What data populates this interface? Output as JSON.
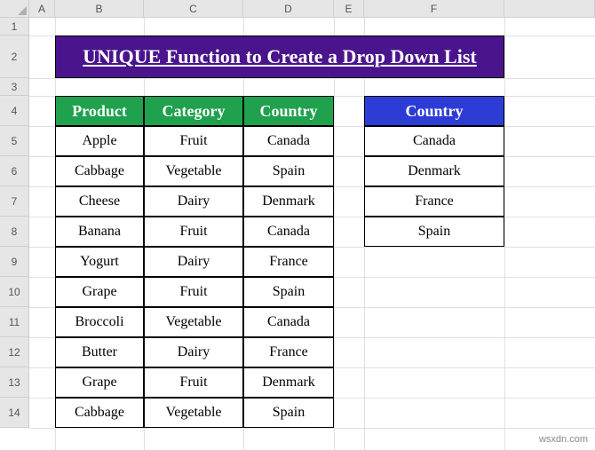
{
  "columns": [
    "A",
    "B",
    "C",
    "D",
    "E",
    "F"
  ],
  "rows": [
    "1",
    "2",
    "3",
    "4",
    "5",
    "6",
    "7",
    "8",
    "9",
    "10",
    "11",
    "12",
    "13",
    "14"
  ],
  "title": "UNIQUE Function to Create a Drop Down List",
  "main_table": {
    "headers": [
      "Product",
      "Category",
      "Country"
    ],
    "data": [
      [
        "Apple",
        "Fruit",
        "Canada"
      ],
      [
        "Cabbage",
        "Vegetable",
        "Spain"
      ],
      [
        "Cheese",
        "Dairy",
        "Denmark"
      ],
      [
        "Banana",
        "Fruit",
        "Canada"
      ],
      [
        "Yogurt",
        "Dairy",
        "France"
      ],
      [
        "Grape",
        "Fruit",
        "Spain"
      ],
      [
        "Broccoli",
        "Vegetable",
        "Canada"
      ],
      [
        "Butter",
        "Dairy",
        "France"
      ],
      [
        "Grape",
        "Fruit",
        "Denmark"
      ],
      [
        "Cabbage",
        "Vegetable",
        "Spain"
      ]
    ]
  },
  "side_table": {
    "header": "Country",
    "data": [
      "Canada",
      "Denmark",
      "France",
      "Spain"
    ]
  },
  "watermark": "wsxdn.com"
}
